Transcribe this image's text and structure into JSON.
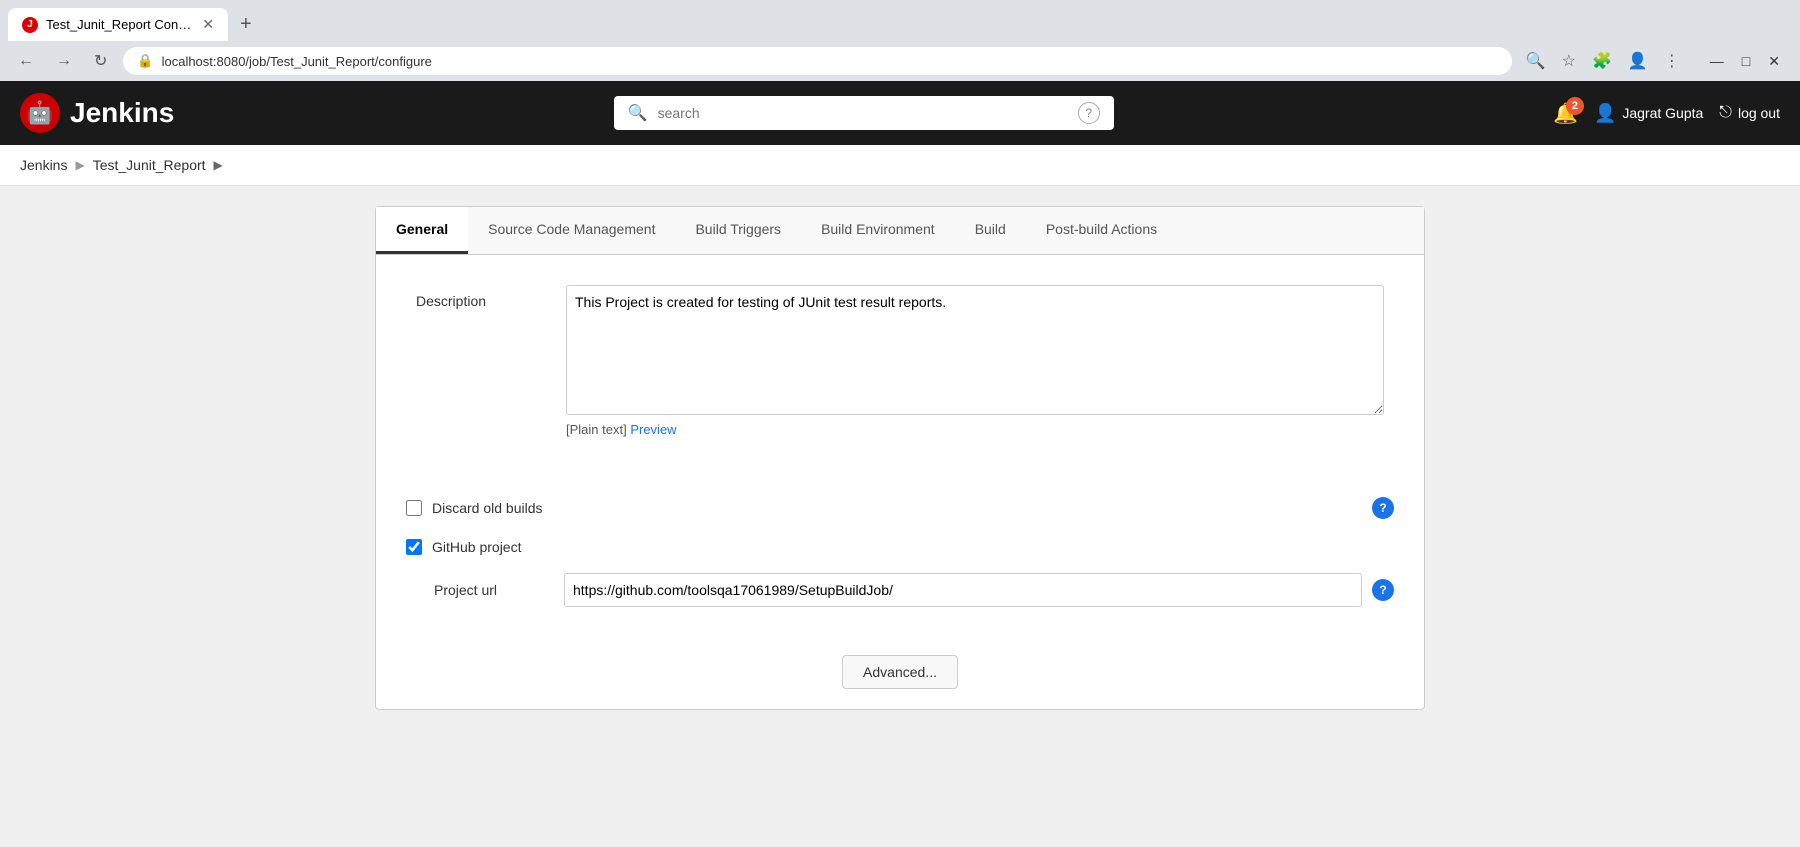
{
  "browser": {
    "tab_title": "Test_Junit_Report Config [Jenkins",
    "url": "localhost:8080/job/Test_Junit_Report/configure",
    "new_tab_label": "+",
    "close_label": "✕",
    "back_label": "←",
    "forward_label": "→",
    "reload_label": "↻",
    "minimize_label": "—",
    "maximize_label": "□",
    "close_window_label": "✕"
  },
  "header": {
    "logo_text": "Jenkins",
    "search_placeholder": "search",
    "help_label": "?",
    "notifications_count": "2",
    "user_name": "Jagrat Gupta",
    "logout_label": "log out"
  },
  "breadcrumb": {
    "root": "Jenkins",
    "project": "Test_Junit_Report"
  },
  "config": {
    "tabs": [
      {
        "id": "general",
        "label": "General",
        "active": true
      },
      {
        "id": "scm",
        "label": "Source Code Management",
        "active": false
      },
      {
        "id": "triggers",
        "label": "Build Triggers",
        "active": false
      },
      {
        "id": "environment",
        "label": "Build Environment",
        "active": false
      },
      {
        "id": "build",
        "label": "Build",
        "active": false
      },
      {
        "id": "postbuild",
        "label": "Post-build Actions",
        "active": false
      }
    ],
    "description_label": "Description",
    "description_value": "This Project is created for testing of JUnit test result reports.",
    "plain_text_label": "[Plain text]",
    "preview_label": "Preview",
    "discard_builds_label": "Discard old builds",
    "github_project_label": "GitHub project",
    "project_url_label": "Project url",
    "project_url_value": "https://github.com/toolsqa17061989/SetupBuildJob/",
    "advanced_btn_label": "Advanced..."
  }
}
